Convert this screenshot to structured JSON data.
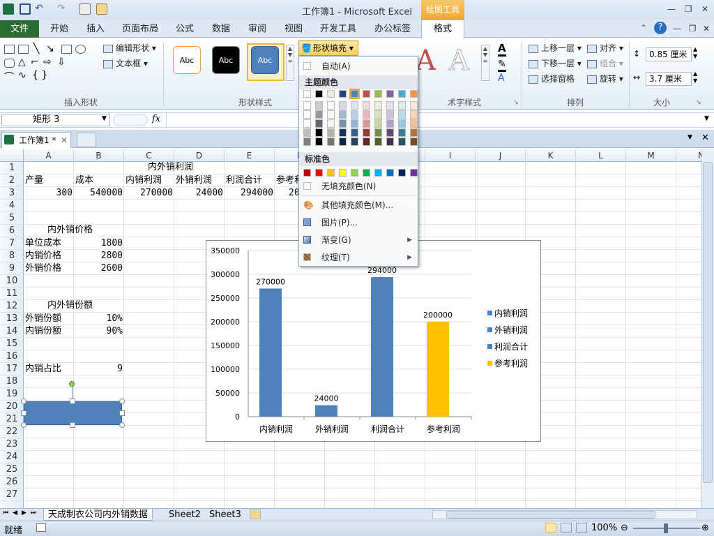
{
  "window": {
    "title": "工作簿1 - Microsoft Excel",
    "context_tab_header": "绘图工具"
  },
  "tabs": [
    "文件",
    "开始",
    "插入",
    "页面布局",
    "公式",
    "数据",
    "审阅",
    "视图",
    "开发工具",
    "办公标签",
    "格式"
  ],
  "ribbon": {
    "groups": {
      "insert_shapes": "插入形状",
      "shape_styles": "形状样式",
      "art_styles": "术字样式",
      "arrange": "排列",
      "size": "大小"
    },
    "edit_shape": "编辑形状",
    "text_box": "文本框",
    "style_abc": "Abc",
    "fill_button": "形状填充",
    "bring_forward": "上移一层",
    "send_backward": "下移一层",
    "selection_pane": "选择窗格",
    "align": "对齐",
    "group": "组合",
    "rotate": "旋转",
    "height": "0.85 厘米",
    "width": "3.7 厘米"
  },
  "formula_bar": {
    "name_box": "矩形 3",
    "fx": "fx",
    "content": ""
  },
  "workbook_tab": "工作簿1 *",
  "columns": [
    "A",
    "B",
    "C",
    "D",
    "E",
    "F",
    "G",
    "H",
    "I",
    "J",
    "K",
    "L",
    "M",
    "N"
  ],
  "rows": [
    "1",
    "2",
    "3",
    "4",
    "5",
    "6",
    "7",
    "8",
    "9",
    "10",
    "11",
    "12",
    "13",
    "14",
    "15",
    "16",
    "17",
    "18",
    "19",
    "20",
    "21",
    "22",
    "23",
    "24",
    "25",
    "26",
    "27"
  ],
  "cells": {
    "title_profit": "内外销利润",
    "h_output": "产量",
    "h_cost": "成本",
    "h_dom_profit": "内销利润",
    "h_exp_profit": "外销利润",
    "h_total": "利润合计",
    "h_ref": "参考利",
    "v_output": "300",
    "v_cost": "540000",
    "v_dom": "270000",
    "v_exp": "24000",
    "v_total": "294000",
    "v_ref": "20",
    "title_price": "内外销价格",
    "unit_cost": "单位成本",
    "unit_cost_v": "1800",
    "dom_price": "内销价格",
    "dom_price_v": "2800",
    "exp_price": "外销价格",
    "exp_price_v": "2600",
    "title_share": "内外销份额",
    "exp_share": "外销份额",
    "exp_share_v": "10%",
    "dom_share": "内销份额",
    "dom_share_v": "90%",
    "dom_ratio": "内销占比",
    "dom_ratio_v": "9"
  },
  "chart_data": {
    "type": "bar",
    "categories": [
      "内销利润",
      "外销利润",
      "利润合计",
      "参考利润"
    ],
    "values": [
      270000,
      24000,
      294000,
      200000
    ],
    "value_labels": [
      "270000",
      "24000",
      "294000",
      "200000"
    ],
    "colors": [
      "#4f81bd",
      "#4f81bd",
      "#4f81bd",
      "#ffc000"
    ],
    "ylim": [
      0,
      350000
    ],
    "yticks": [
      "0",
      "50000",
      "100000",
      "150000",
      "200000",
      "250000",
      "300000",
      "350000"
    ],
    "legend": [
      "内销利润",
      "外销利润",
      "利润合计",
      "参考利润"
    ],
    "legend_position": "right",
    "title": "",
    "xlabel": "",
    "ylabel": ""
  },
  "fill_menu": {
    "auto": "自动(A)",
    "theme_colors": "主题颜色",
    "standard_colors": "标准色",
    "no_fill": "无填充颜色(N)",
    "more_colors": "其他填充颜色(M)...",
    "picture": "图片(P)...",
    "gradient": "渐变(G)",
    "texture": "纹理(T)",
    "theme_row": [
      "#ffffff",
      "#000000",
      "#eeece1",
      "#1f497d",
      "#4f81bd",
      "#c0504d",
      "#9bbb59",
      "#8064a2",
      "#4bacc6",
      "#f79646"
    ],
    "standard_row": [
      "#c00000",
      "#ff0000",
      "#ffc000",
      "#ffff00",
      "#92d050",
      "#00b050",
      "#00b0f0",
      "#0070c0",
      "#002060",
      "#7030a0"
    ]
  },
  "sheet_tabs": [
    "天成制衣公司内外销数据",
    "Sheet2",
    "Sheet3"
  ],
  "status": {
    "ready": "就绪",
    "zoom": "100%"
  }
}
